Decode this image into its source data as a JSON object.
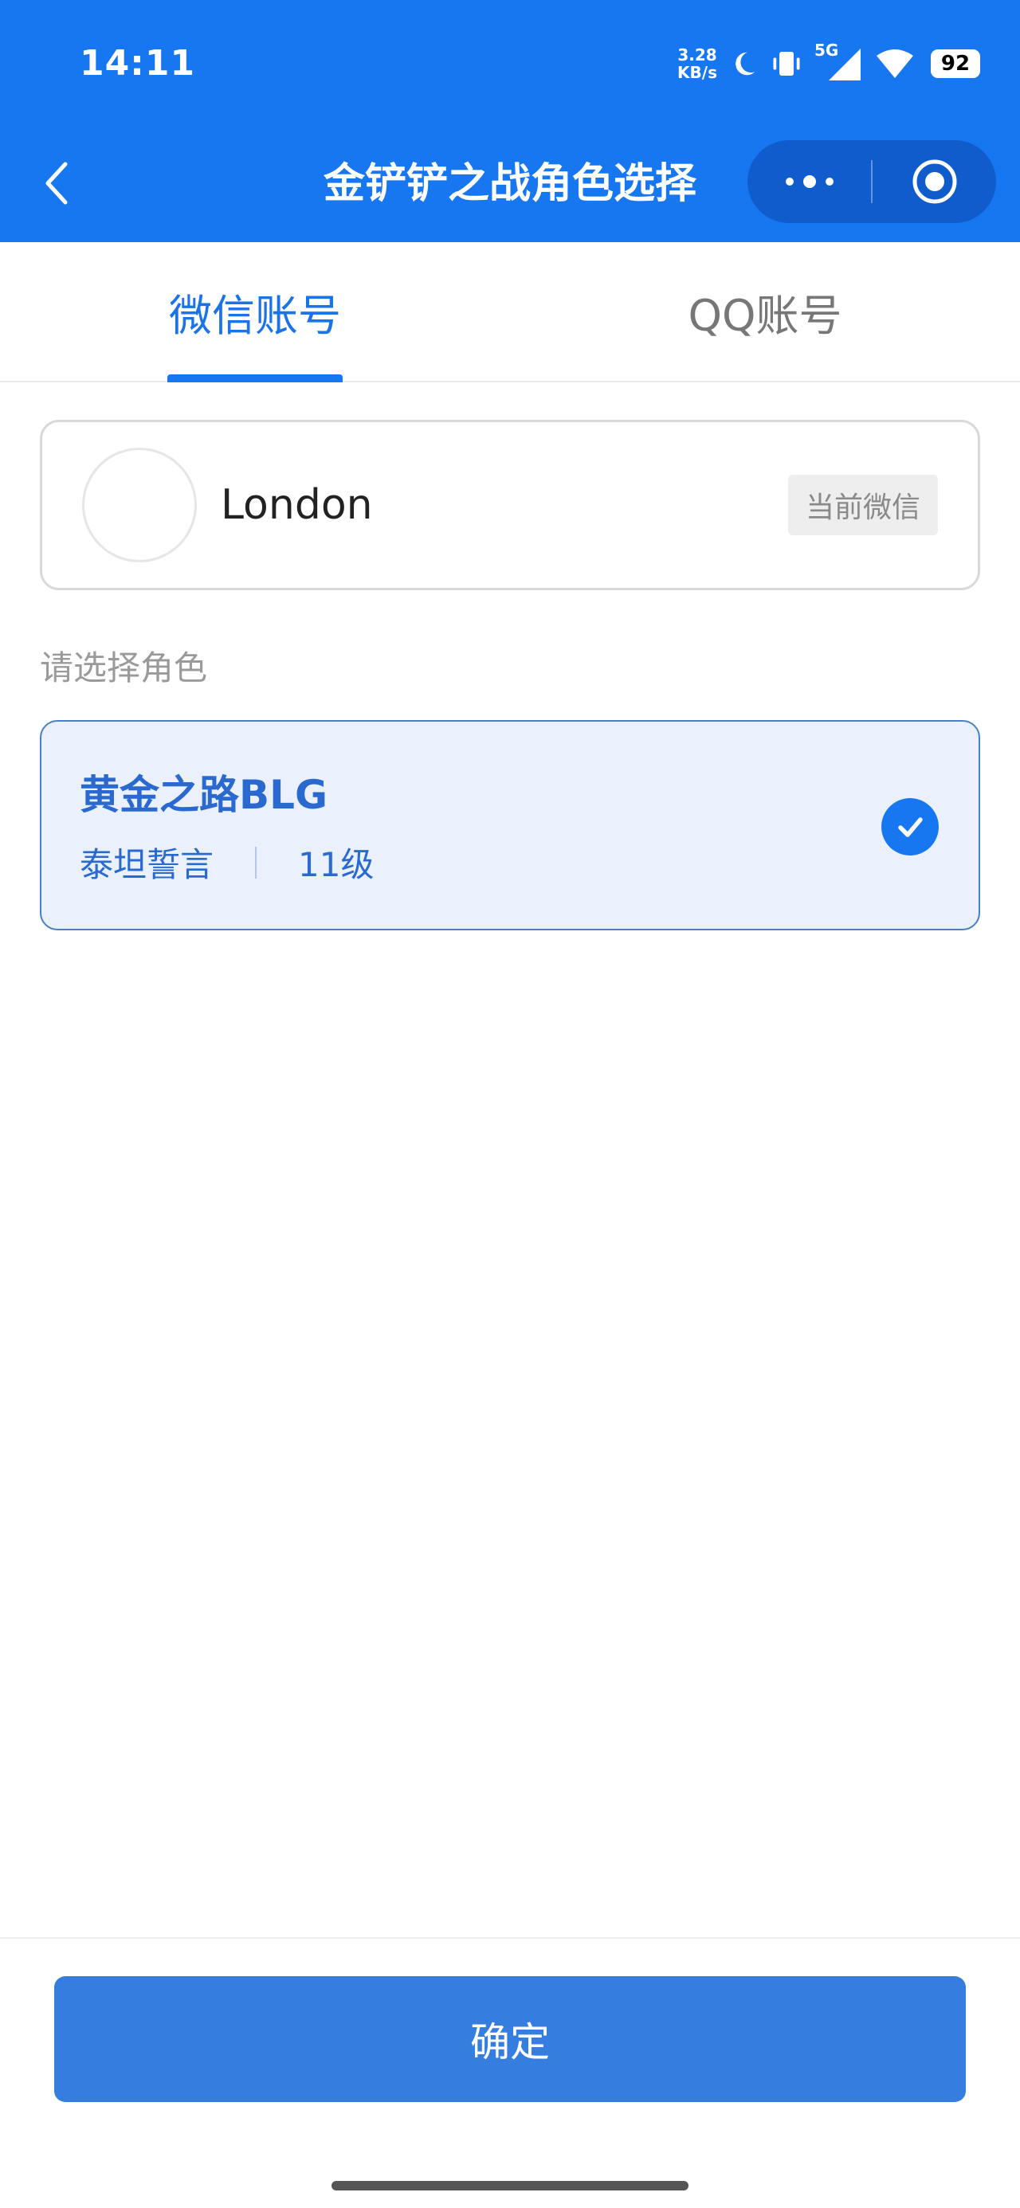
{
  "status_bar": {
    "time": "14:11",
    "net_speed_value": "3.28",
    "net_speed_unit": "KB/s",
    "network_type": "5G",
    "battery": "92",
    "icons": [
      "moon-icon",
      "vibrate-icon",
      "signal-icon",
      "wifi-icon",
      "battery-icon"
    ]
  },
  "header": {
    "title": "金铲铲之战角色选择",
    "back_icon": "chevron-left-icon",
    "more_icon": "more-dots-icon",
    "close_icon": "target-circle-icon",
    "color": "#1677f0"
  },
  "tabs": [
    {
      "label": "微信账号",
      "active": true
    },
    {
      "label": "QQ账号",
      "active": false
    }
  ],
  "account": {
    "name": "London",
    "tag": "当前微信"
  },
  "section_label": "请选择角色",
  "role": {
    "name": "黄金之路BLG",
    "server": "泰坦誓言",
    "level": "11级",
    "selected": true
  },
  "confirm_label": "确定",
  "colors": {
    "primary": "#1677f0",
    "button": "#367de0",
    "role_bg": "#eaf1fd",
    "role_text": "#2a6ad0"
  }
}
